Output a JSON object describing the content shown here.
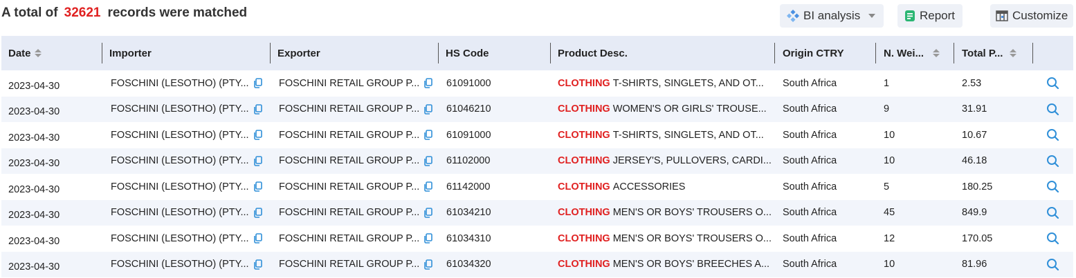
{
  "summary": {
    "prefix": "A total of",
    "count": "32621",
    "suffix": "records were matched"
  },
  "toolbar": {
    "bi_label": "BI analysis",
    "report_label": "Report",
    "customize_label": "Customize"
  },
  "colors": {
    "accent": "#e02020",
    "icon_blue": "#2f8fd8",
    "header_bg": "#e6ebf6",
    "stripe_bg": "#f2f5fb"
  },
  "table": {
    "headers": {
      "date": "Date",
      "importer": "Importer",
      "exporter": "Exporter",
      "hs": "HS Code",
      "product": "Product Desc.",
      "origin": "Origin CTRY",
      "weight": "N. Wei...",
      "total": "Total P..."
    },
    "keyword": "CLOTHING",
    "rows": [
      {
        "date": "2023-04-30",
        "importer": "FOSCHINI (LESOTHO) (PTY...",
        "exporter": "FOSCHINI RETAIL GROUP P...",
        "hs": "61091000",
        "product": "T-SHIRTS, SINGLETS, AND OT...",
        "origin": "South Africa",
        "weight": "1",
        "total": "2.53"
      },
      {
        "date": "2023-04-30",
        "importer": "FOSCHINI (LESOTHO) (PTY...",
        "exporter": "FOSCHINI RETAIL GROUP P...",
        "hs": "61046210",
        "product": "WOMEN'S OR GIRLS' TROUSE...",
        "origin": "South Africa",
        "weight": "9",
        "total": "31.91"
      },
      {
        "date": "2023-04-30",
        "importer": "FOSCHINI (LESOTHO) (PTY...",
        "exporter": "FOSCHINI RETAIL GROUP P...",
        "hs": "61091000",
        "product": "T-SHIRTS, SINGLETS, AND OT...",
        "origin": "South Africa",
        "weight": "10",
        "total": "10.67"
      },
      {
        "date": "2023-04-30",
        "importer": "FOSCHINI (LESOTHO) (PTY...",
        "exporter": "FOSCHINI RETAIL GROUP P...",
        "hs": "61102000",
        "product": "JERSEY'S, PULLOVERS, CARDI...",
        "origin": "South Africa",
        "weight": "10",
        "total": "46.18"
      },
      {
        "date": "2023-04-30",
        "importer": "FOSCHINI (LESOTHO) (PTY...",
        "exporter": "FOSCHINI RETAIL GROUP P...",
        "hs": "61142000",
        "product": "ACCESSORIES",
        "origin": "South Africa",
        "weight": "5",
        "total": "180.25"
      },
      {
        "date": "2023-04-30",
        "importer": "FOSCHINI (LESOTHO) (PTY...",
        "exporter": "FOSCHINI RETAIL GROUP P...",
        "hs": "61034210",
        "product": "MEN'S OR BOYS' TROUSERS O...",
        "origin": "South Africa",
        "weight": "45",
        "total": "849.9"
      },
      {
        "date": "2023-04-30",
        "importer": "FOSCHINI (LESOTHO) (PTY...",
        "exporter": "FOSCHINI RETAIL GROUP P...",
        "hs": "61034310",
        "product": "MEN'S OR BOYS' TROUSERS O...",
        "origin": "South Africa",
        "weight": "12",
        "total": "170.05"
      },
      {
        "date": "2023-04-30",
        "importer": "FOSCHINI (LESOTHO) (PTY...",
        "exporter": "FOSCHINI RETAIL GROUP P...",
        "hs": "61034320",
        "product": "MEN'S OR BOYS' BREECHES A...",
        "origin": "South Africa",
        "weight": "10",
        "total": "81.96"
      }
    ]
  }
}
